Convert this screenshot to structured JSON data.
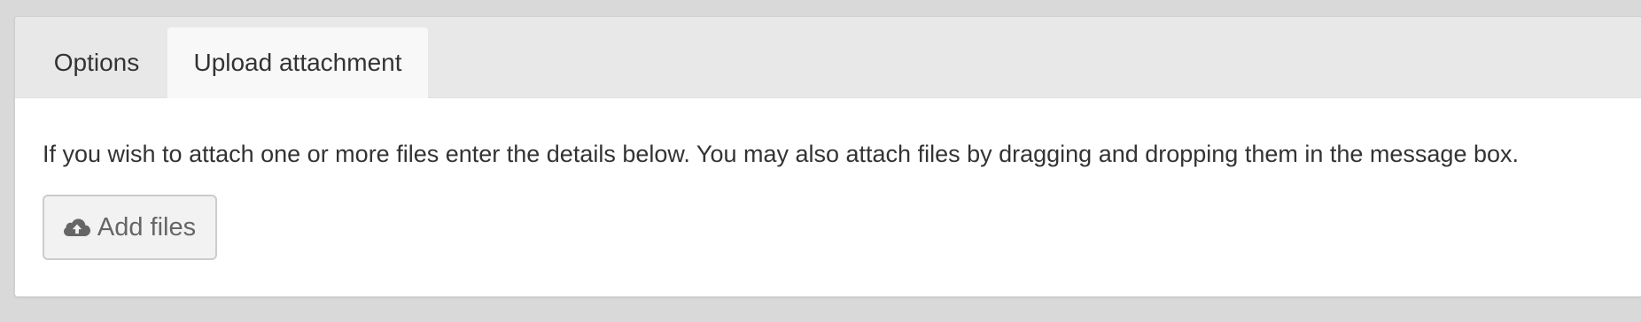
{
  "tabs": [
    {
      "label": "Options",
      "active": false
    },
    {
      "label": "Upload attachment",
      "active": true
    }
  ],
  "upload": {
    "instructions": "If you wish to attach one or more files enter the details below. You may also attach files by dragging and dropping them in the message box.",
    "add_files_label": "Add files",
    "add_files_icon": "cloud-upload-icon"
  },
  "colors": {
    "page_background": "#d9d9d9",
    "tabbar_background": "#e8e8e8",
    "active_tab_background": "#f8f8f8",
    "button_background": "#f2f2f2",
    "button_text": "#666666",
    "text": "#333333"
  }
}
